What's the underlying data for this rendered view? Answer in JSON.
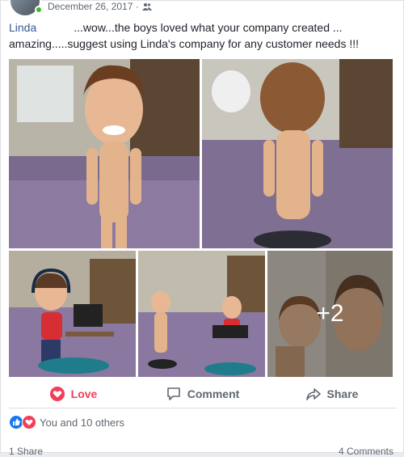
{
  "post": {
    "date": "December 26, 2017 ·",
    "privacy_icon": "friends-icon",
    "author": "Linda",
    "text_part1": "...wow...the boys loved what your company created ...",
    "text_part2": "amazing.....suggest using Linda's company for any customer needs !!!"
  },
  "photos": {
    "more_count": "+2"
  },
  "actions": {
    "love": "Love",
    "comment": "Comment",
    "share": "Share"
  },
  "reactions": {
    "summary": "You and 10 others",
    "icons": [
      "like-icon",
      "heart-icon"
    ]
  },
  "footer": {
    "shares": "1 Share",
    "comments": "4 Comments"
  },
  "colors": {
    "link": "#385898",
    "love": "#f33e58",
    "like": "#1877f2",
    "online": "#42b72a"
  }
}
